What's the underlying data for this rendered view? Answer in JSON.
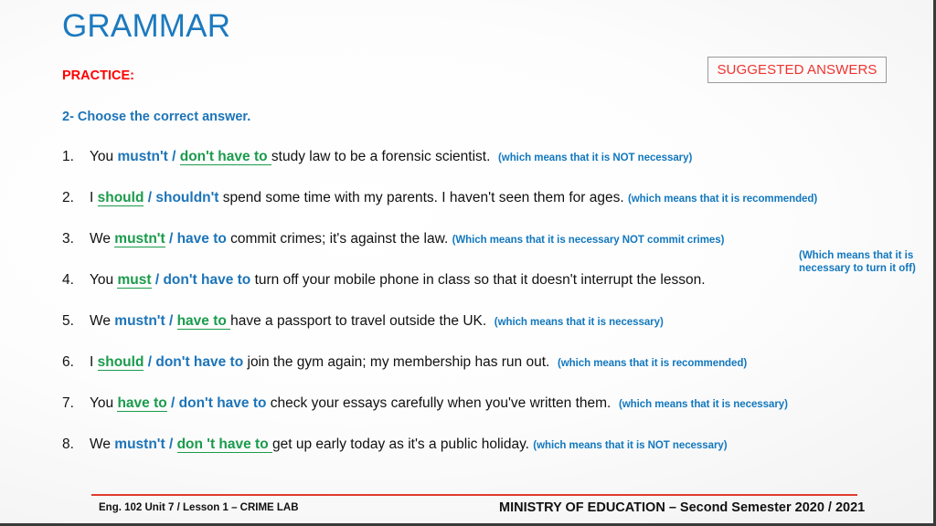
{
  "slide": {
    "title": "GRAMMAR",
    "practice_label": "PRACTICE:",
    "suggested_answers_label": "SUGGESTED ANSWERS",
    "instruction": "2- Choose the correct answer."
  },
  "questions": [
    {
      "num": "1.",
      "pre": "You ",
      "opt_a": "mustn't",
      "opt_a_style": "blue",
      "sep": " / ",
      "opt_b": "don't have to ",
      "opt_b_style": "green",
      "post": "study law to be a forensic scientist.",
      "note": "(which means that it is NOT necessary)"
    },
    {
      "num": "2.",
      "pre": "I ",
      "opt_a": "should",
      "opt_a_style": "green",
      "sep": " / ",
      "opt_b": "shouldn't",
      "opt_b_style": "blue",
      "post": " spend some time with my parents. I haven't seen them for ages.",
      "note": "(which means that it is recommended)"
    },
    {
      "num": "3.",
      "pre": "We ",
      "opt_a": "mustn't",
      "opt_a_style": "green",
      "sep": " / ",
      "opt_b": "have to",
      "opt_b_style": "blue",
      "post": " commit crimes; it's against the law.",
      "note": "(Which means that it is necessary NOT commit crimes)"
    },
    {
      "num": "4.",
      "pre": "You ",
      "opt_a": "must",
      "opt_a_style": "green",
      "sep": " / ",
      "opt_b": "don't have to",
      "opt_b_style": "blue",
      "post": " turn off your mobile phone in class so that it doesn't interrupt the lesson.",
      "note": "(Which means that it is necessary to turn it off)"
    },
    {
      "num": "5.",
      "pre": "We ",
      "opt_a": "mustn't",
      "opt_a_style": "blue",
      "sep": " / ",
      "opt_b": "have to ",
      "opt_b_style": "green",
      "post": "have a passport to travel outside the UK.",
      "note": "(which means that it is necessary)"
    },
    {
      "num": "6.",
      "pre": "I ",
      "opt_a": "should",
      "opt_a_style": "green",
      "sep": " / ",
      "opt_b": "don't have to",
      "opt_b_style": "blue",
      "post": " join the gym again; my membership has run out.",
      "note": "(which means that it is recommended)"
    },
    {
      "num": "7.",
      "pre": "You ",
      "opt_a": "have to",
      "opt_a_style": "green",
      "sep": " / ",
      "opt_b": "don't have to",
      "opt_b_style": "blue",
      "post": " check your essays carefully when you've written them.",
      "note": "(which means that it is necessary)"
    },
    {
      "num": "8.",
      "pre": "We ",
      "opt_a": "mustn't",
      "opt_a_style": "blue",
      "sep": " / ",
      "opt_b": "don 't have to ",
      "opt_b_style": "green",
      "post": "get up early today as it's a public holiday.",
      "note": "(which means that it is NOT necessary)"
    }
  ],
  "footer": {
    "left": "Eng. 102 Unit 7 / Lesson 1 – CRIME LAB",
    "right": "MINISTRY OF EDUCATION – Second Semester 2020 / 2021"
  },
  "colors": {
    "title_blue": "#1C7ABF",
    "practice_red": "#FF0000",
    "option_green": "#1A9B4C",
    "option_blue": "#1C74B8",
    "note_blue": "#1278BE",
    "footer_rule_red": "#E03B2E",
    "suggested_red": "#F0322E"
  }
}
